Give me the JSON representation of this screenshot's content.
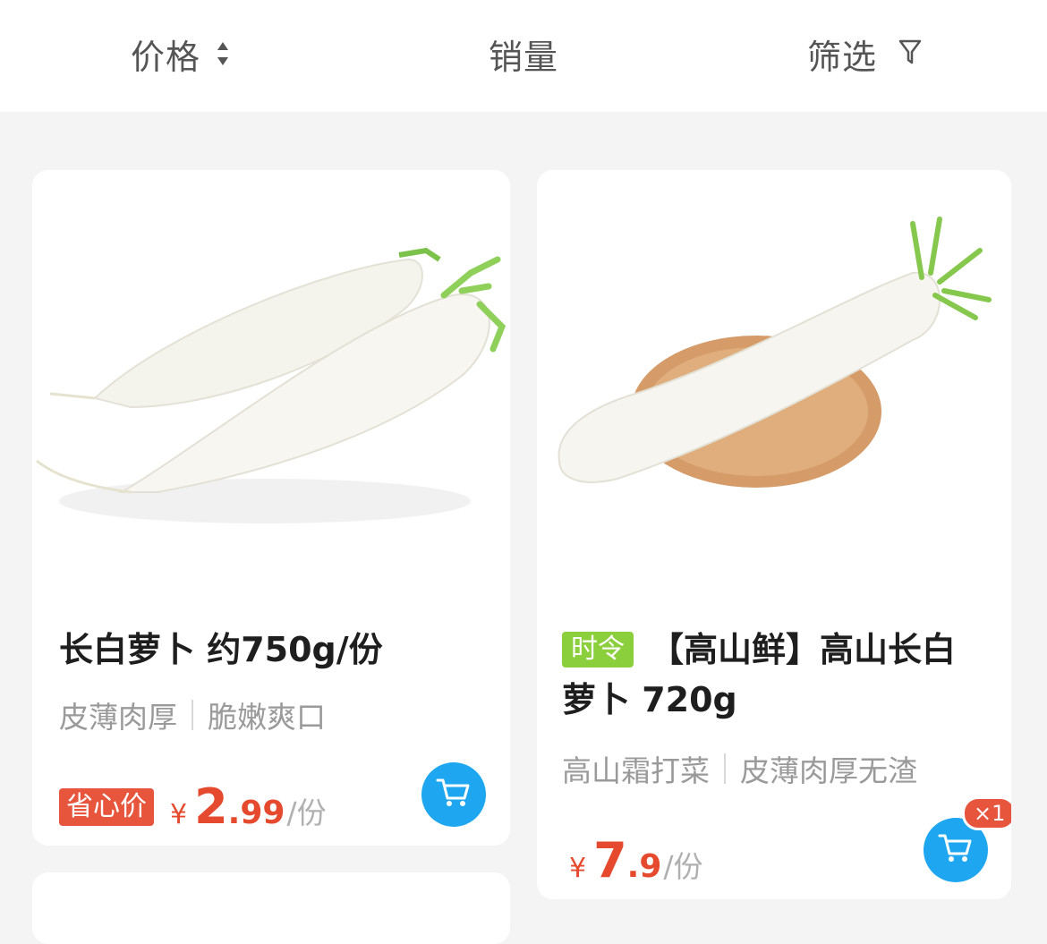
{
  "sort_bar": {
    "price_label": "价格",
    "sales_label": "销量",
    "filter_label": "筛选"
  },
  "products": [
    {
      "title": "长白萝卜 约750g/份",
      "features": [
        "皮薄肉厚",
        "脆嫩爽口"
      ],
      "badge": "省心价",
      "currency": "¥",
      "price_int": "2",
      "price_dec": ".99",
      "unit": "/份"
    },
    {
      "tag": "时令",
      "title": "【高山鲜】高山长白萝卜 720g",
      "features": [
        "高山霜打菜",
        "皮薄肉厚无渣"
      ],
      "currency": "¥",
      "price_int": "7",
      "price_dec": ".9",
      "unit": "/份",
      "cart_count": "×1"
    }
  ],
  "colors": {
    "price": "#e64a2e",
    "cart_button": "#1ea7f0",
    "seasonal_tag": "#8bcf3c",
    "save_badge": "#e8553d"
  }
}
